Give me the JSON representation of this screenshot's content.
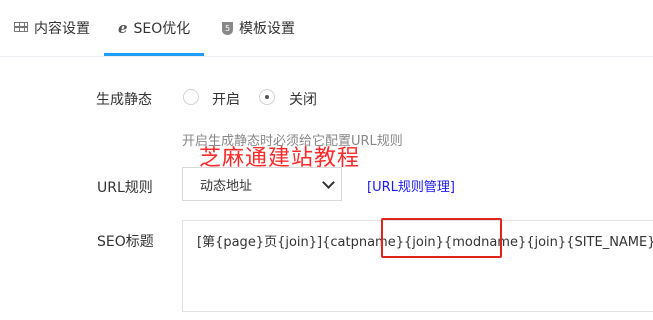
{
  "tabs": {
    "content_settings": "内容设置",
    "seo": "SEO优化",
    "template_settings": "模板设置"
  },
  "form": {
    "static": {
      "label": "生成静态",
      "option_on": "开启",
      "option_off": "关闭",
      "selected": "关闭",
      "hint": "开启生成静态时必须给它配置URL规则"
    },
    "url_rule": {
      "label": "URL规则",
      "selected_value": "动态地址",
      "manage_link": "[URL规则管理]"
    },
    "seo_title": {
      "label": "SEO标题",
      "value": "[第{page}页{join}]{catpname}{join}{modname}{join}{SITE_NAME}"
    }
  },
  "watermark": "芝麻通建站教程",
  "colors": {
    "accent": "#1e9fff",
    "highlight_box": "#e0241b",
    "watermark": "#ff2a2a",
    "link": "#1a1aff"
  },
  "icons": {
    "content_settings": "grid-icon",
    "seo": "ie-e-icon",
    "template_settings": "html5-icon"
  }
}
